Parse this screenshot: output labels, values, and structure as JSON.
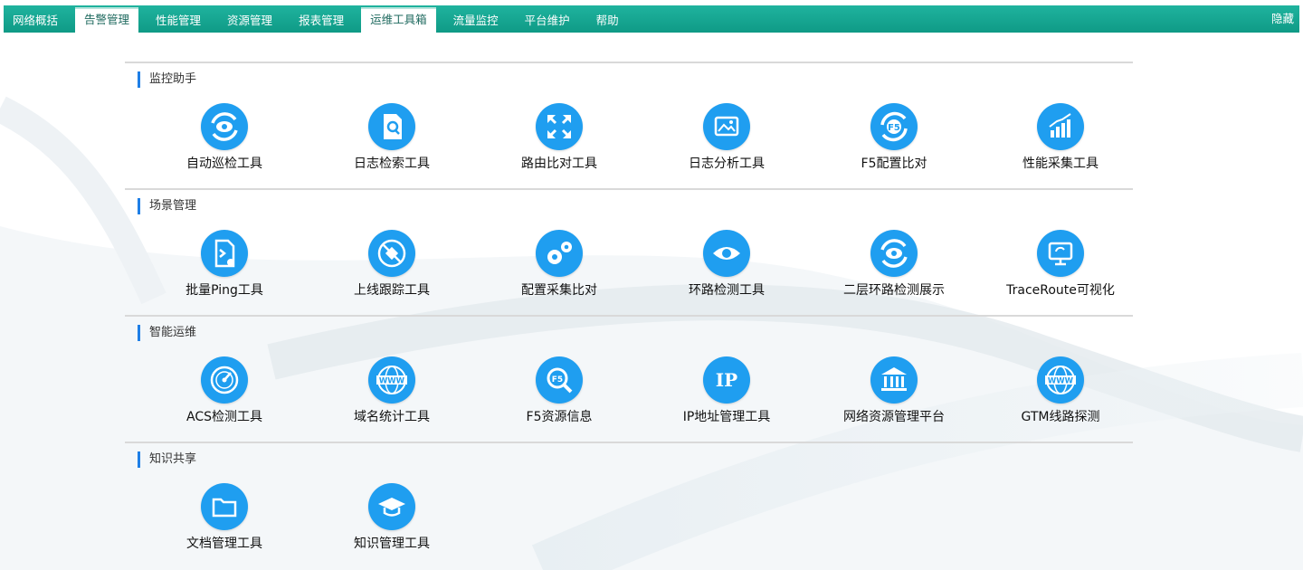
{
  "nav": {
    "items": [
      {
        "label": "网络概括",
        "active": false
      },
      {
        "label": "告警管理",
        "active": true
      },
      {
        "label": "性能管理",
        "active": false
      },
      {
        "label": "资源管理",
        "active": false
      },
      {
        "label": "报表管理",
        "active": false
      },
      {
        "label": "运维工具箱",
        "active": true
      },
      {
        "label": "流量监控",
        "active": false
      },
      {
        "label": "平台维护",
        "active": false
      },
      {
        "label": "帮助",
        "active": false
      }
    ],
    "right_label": "隐藏"
  },
  "sections": [
    {
      "title": "监控助手",
      "tools": [
        {
          "label": "自动巡检工具",
          "icon": "refresh-eye-icon"
        },
        {
          "label": "日志检索工具",
          "icon": "doc-search-icon"
        },
        {
          "label": "路由比对工具",
          "icon": "expand-arrows-icon"
        },
        {
          "label": "日志分析工具",
          "icon": "image-log-icon"
        },
        {
          "label": "F5配置比对",
          "icon": "f5-refresh-icon"
        },
        {
          "label": "性能采集工具",
          "icon": "bar-chart-icon"
        }
      ]
    },
    {
      "title": "场景管理",
      "tools": [
        {
          "label": "批量Ping工具",
          "icon": "terminal-file-icon"
        },
        {
          "label": "上线跟踪工具",
          "icon": "satellite-icon"
        },
        {
          "label": "配置采集比对",
          "icon": "gears-icon"
        },
        {
          "label": "环路检测工具",
          "icon": "eye-icon"
        },
        {
          "label": "二层环路检测展示",
          "icon": "refresh-eye-icon"
        },
        {
          "label": "TraceRoute可视化",
          "icon": "monitor-icon"
        }
      ]
    },
    {
      "title": "智能运维",
      "tools": [
        {
          "label": "ACS检测工具",
          "icon": "gauge-icon"
        },
        {
          "label": "域名统计工具",
          "icon": "www-globe-icon"
        },
        {
          "label": "F5资源信息",
          "icon": "f5-search-icon"
        },
        {
          "label": "IP地址管理工具",
          "icon": "ip-pin-icon"
        },
        {
          "label": "网络资源管理平台",
          "icon": "bank-icon"
        },
        {
          "label": "GTM线路探测",
          "icon": "www-globe-icon"
        }
      ]
    },
    {
      "title": "知识共享",
      "tools": [
        {
          "label": "文档管理工具",
          "icon": "folder-icon"
        },
        {
          "label": "知识管理工具",
          "icon": "graduation-cap-icon"
        }
      ]
    }
  ],
  "colors": {
    "nav": "#12a38e",
    "accent": "#1f9ef0",
    "section_bar": "#1f7fe6"
  }
}
